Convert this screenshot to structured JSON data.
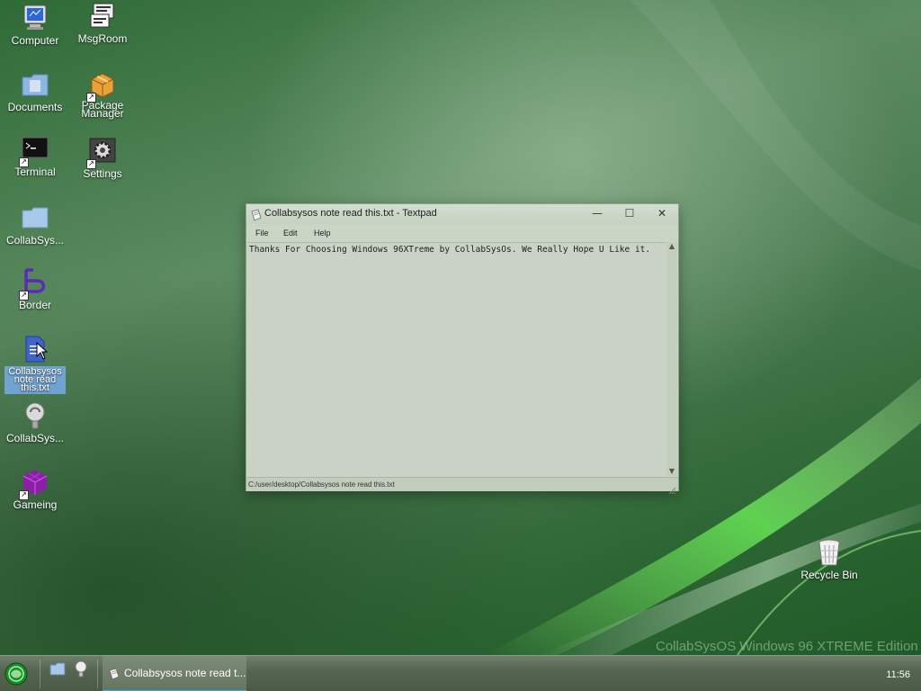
{
  "desktop": {
    "icons": [
      {
        "label": "Computer"
      },
      {
        "label": "MsgRoom"
      },
      {
        "label": "Documents"
      },
      {
        "label": "Package Manager"
      },
      {
        "label": "Terminal"
      },
      {
        "label": "Settings"
      },
      {
        "label": "CollabSys..."
      },
      {
        "label": "Border"
      },
      {
        "label": "Collabsysos note read this.txt"
      },
      {
        "label": "CollabSys..."
      },
      {
        "label": "Gameing"
      },
      {
        "label": "Recycle Bin"
      }
    ],
    "edition_text": "CollabSysOS Windows 96 XTREME Edition"
  },
  "window": {
    "title": "Collabsysos note read this.txt - Textpad",
    "menu": [
      "File",
      "Edit",
      "Help"
    ],
    "content": "Thanks For Choosing Windows 96XTreme by CollabSysOs. We Really Hope U Like it.",
    "status_path": "C:/user/desktop/Collabsysos note read this.txt",
    "buttons": {
      "minimize": "—",
      "maximize": "☐",
      "close": "✕"
    }
  },
  "taskbar": {
    "active_task_label": "Collabsysos note read t...",
    "clock": "11:56"
  },
  "colors": {
    "wallpaper_green": "#3f7a46",
    "window_bg": "#c9d5c5",
    "taskbar": "#55654f",
    "task_active_indicator": "#3fa4e8",
    "selection": "#78aae6"
  }
}
